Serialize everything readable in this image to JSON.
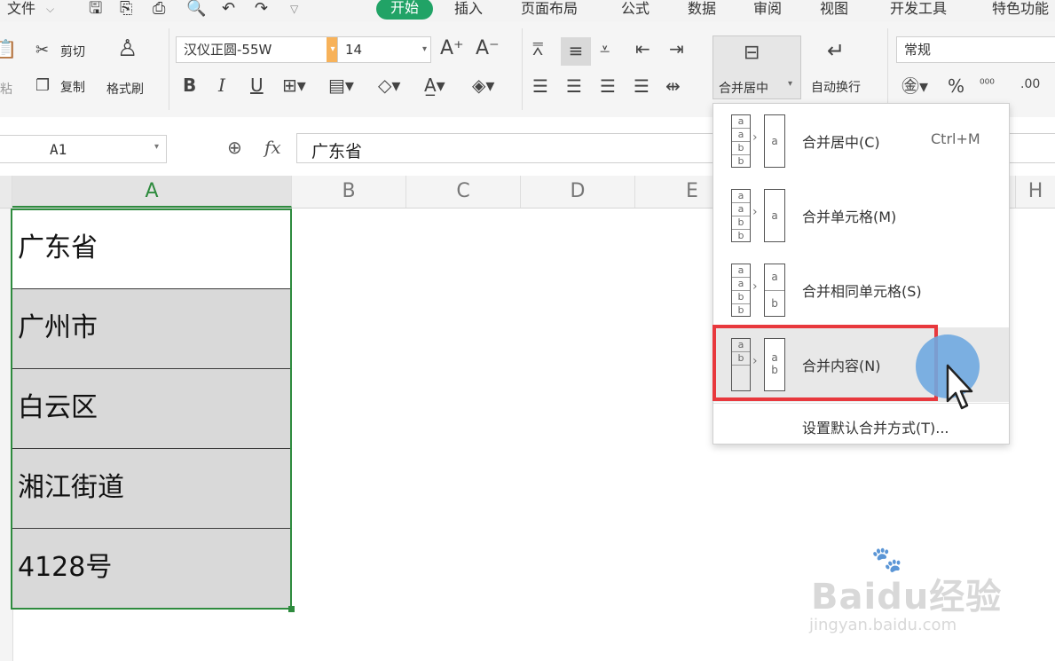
{
  "menu": {
    "file": "文件",
    "tabs": [
      "开始",
      "插入",
      "页面布局",
      "公式",
      "数据",
      "审阅",
      "视图",
      "开发工具",
      "特色功能"
    ]
  },
  "ribbon": {
    "cut": "剪切",
    "copy": "复制",
    "paste_partial": "粘",
    "format_painter": "格式刷",
    "font_name": "汉仪正圆-55W",
    "font_size": "14",
    "merge_center": "合并居中",
    "auto_wrap": "自动换行",
    "number_format": "常规",
    "bold": "B",
    "italic": "I",
    "underline": "U",
    "percent": "%"
  },
  "formula": {
    "name_box": "A1",
    "fx": "fx",
    "content": "广东省"
  },
  "columns": [
    "A",
    "B",
    "C",
    "D",
    "E",
    "H"
  ],
  "cells": [
    "广东省",
    "广州市",
    "白云区",
    "湘江街道",
    "4128号"
  ],
  "dropdown": {
    "items": [
      {
        "label": "合并居中(C)",
        "shortcut": "Ctrl+M"
      },
      {
        "label": "合并单元格(M)",
        "shortcut": ""
      },
      {
        "label": "合并相同单元格(S)",
        "shortcut": ""
      },
      {
        "label": "合并内容(N)",
        "shortcut": ""
      }
    ],
    "footer": "设置默认合并方式(T)..."
  },
  "mini_letters": {
    "a": "a",
    "b": "b"
  },
  "watermark": {
    "logo": "Baidu经验",
    "url": "jingyan.baidu.com"
  },
  "colors": {
    "accent": "#21a366",
    "highlight": "#e8383d",
    "selection": "#2e8b3e",
    "cursor_circle": "#6fa8e0"
  }
}
